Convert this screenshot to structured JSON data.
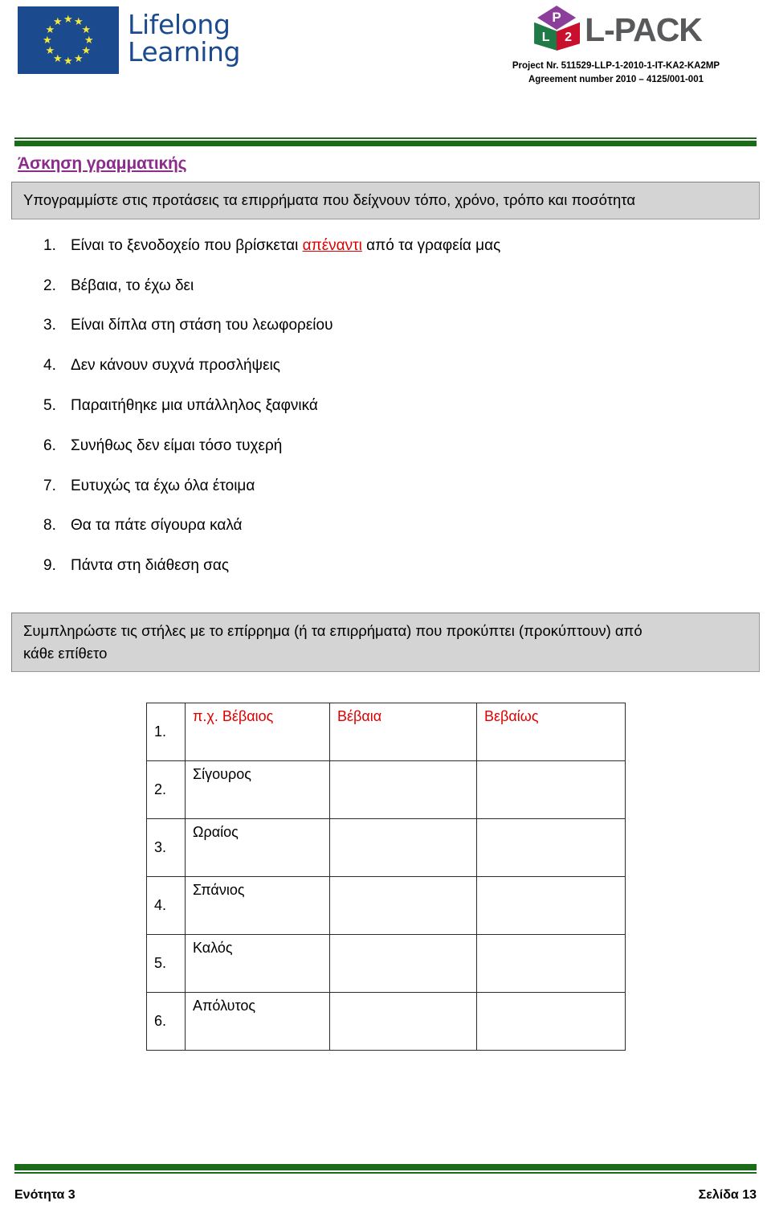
{
  "header": {
    "eu_logo": {
      "name": "lifelong-learning-logo",
      "line1": "Lifelong",
      "line2": "Learning",
      "flag_color": "#1B4A8F",
      "star_color": "#F4E93B",
      "text_color": "#1B4A8F"
    },
    "lpack_logo": {
      "name": "l-pack-logo",
      "wordmark": "L-PACK",
      "cube_top_letter": "P",
      "cube_left_letter": "L",
      "cube_right_letter": "2",
      "cube_top_color": "#8C3E9B",
      "cube_left_color": "#1F7A47",
      "cube_right_color": "#C8102E",
      "wordmark_color": "#58595B"
    },
    "project_number": "Project Nr. 511529-LLP-1-2010-1-IT-KA2-KA2MP",
    "agreement_number": "Agreement number 2010 – 4125/001-001"
  },
  "divider_color": "#1A6B1A",
  "main": {
    "title": "Άσκηση γραμματικής",
    "title_color": "#8B2C8B",
    "instruction_1": "Υπογραμμίστε στις προτάσεις τα επιρρήματα που δείχνουν τόπο, χρόνο, τρόπο και ποσότητα",
    "sentences": [
      {
        "number": "1.",
        "before": "Είναι το ξενοδοχείο που βρίσκεται ",
        "highlight": "απέναντι",
        "after": " από τα γραφεία μας"
      },
      {
        "number": "2.",
        "before": "Βέβαια, το έχω δει",
        "highlight": "",
        "after": ""
      },
      {
        "number": "3.",
        "before": "Είναι δίπλα στη στάση του λεωφορείου",
        "highlight": "",
        "after": ""
      },
      {
        "number": "4.",
        "before": "Δεν κάνουν συχνά προσλήψεις",
        "highlight": "",
        "after": ""
      },
      {
        "number": "5.",
        "before": "Παραιτήθηκε μια υπάλληλος ξαφνικά",
        "highlight": "",
        "after": ""
      },
      {
        "number": "6.",
        "before": "Συνήθως δεν είμαι τόσο τυχερή",
        "highlight": "",
        "after": ""
      },
      {
        "number": "7.",
        "before": "Ευτυχώς τα έχω όλα έτοιμα",
        "highlight": "",
        "after": ""
      },
      {
        "number": "8.",
        "before": "Θα τα πάτε σίγουρα καλά",
        "highlight": "",
        "after": ""
      },
      {
        "number": "9.",
        "before": "Πάντα στη διάθεση σας",
        "highlight": "",
        "after": ""
      }
    ],
    "highlight_color": "#E00000",
    "instruction_2_line1": "Συμπληρώστε τις στήλες με το επίρρημα (ή τα επιρρήματα) που προκύπτει (προκύπτουν) από",
    "instruction_2_line2": "κάθε επίθετο",
    "table": {
      "rows": [
        {
          "index": "1.",
          "adjective": "π.χ. Βέβαιος",
          "adverb1": "Βέβαια",
          "adverb2": "Βεβαίως",
          "is_example": true
        },
        {
          "index": "2.",
          "adjective": "Σίγουρος",
          "adverb1": "",
          "adverb2": "",
          "is_example": false
        },
        {
          "index": "3.",
          "adjective": "Ωραίος",
          "adverb1": "",
          "adverb2": "",
          "is_example": false
        },
        {
          "index": "4.",
          "adjective": "Σπάνιος",
          "adverb1": "",
          "adverb2": "",
          "is_example": false
        },
        {
          "index": "5.",
          "adjective": "Καλός",
          "adverb1": "",
          "adverb2": "",
          "is_example": false
        },
        {
          "index": "6.",
          "adjective": "Απόλυτος",
          "adverb1": "",
          "adverb2": "",
          "is_example": false
        }
      ]
    }
  },
  "footer": {
    "left": "Ενότητα 3",
    "right": "Σελίδα 13"
  }
}
